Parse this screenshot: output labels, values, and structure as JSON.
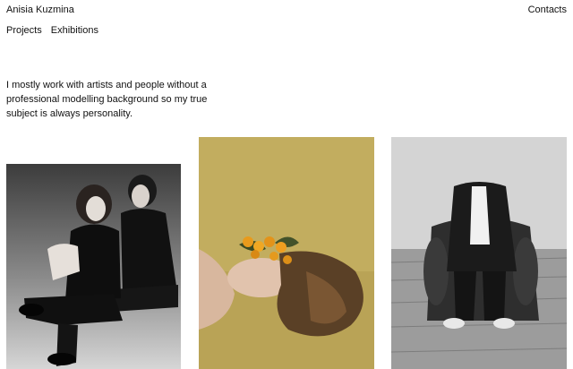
{
  "header": {
    "site_name": "Anisia Kuzmina",
    "contacts_label": "Contacts"
  },
  "nav": {
    "items": [
      {
        "label": "Projects"
      },
      {
        "label": "Exhibitions"
      }
    ]
  },
  "intro": {
    "text": "I mostly work with artists and people without a professional modelling background so my true subject is always personality."
  },
  "gallery": {
    "photos": [
      {
        "subject": "black-and-white portrait of two seated people in black clothing"
      },
      {
        "subject": "woman lying on an olive background with small oranges and leaves across her face"
      },
      {
        "subject": "armchair draped with dark clothing and a white shirt, sneakers on a wooden floor"
      }
    ]
  },
  "colors": {
    "text": "#111111",
    "background": "#ffffff",
    "photo2_background": "#c2ad5f"
  }
}
